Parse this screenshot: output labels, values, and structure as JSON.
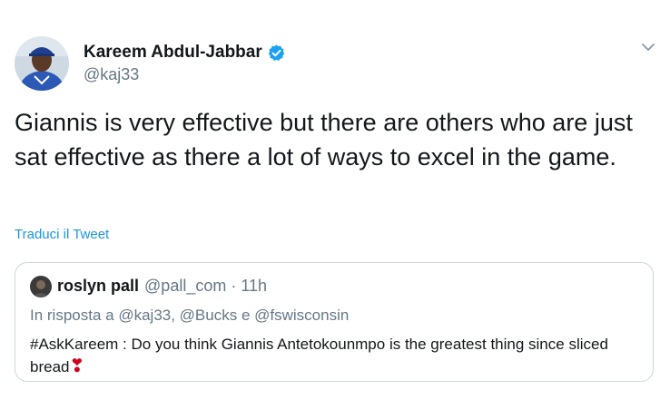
{
  "author": {
    "display_name": "Kareem Abdul-Jabbar",
    "handle": "@kaj33",
    "verified": true
  },
  "tweet": {
    "text": "Giannis is very effective but there are others who are just sat effective as there a lot of ways to excel in the game.",
    "translate_label": "Traduci il Tweet"
  },
  "quoted": {
    "display_name": "roslyn pall",
    "handle": "@pall_com",
    "separator": "·",
    "time": "11h",
    "reply_context": "In risposta a @kaj33, @Bucks e @fswisconsin",
    "text": "#AskKareem : Do you think Giannis Antetokounmpo is the greatest thing since sliced bread",
    "emoji": "❣"
  },
  "icons": {
    "menu": "chevron-down-icon",
    "verified": "verified-badge-icon"
  },
  "colors": {
    "link": "#1b95e0",
    "secondary_text": "#657786",
    "verified": "#1da1f2",
    "border": "#ccd6dd"
  }
}
